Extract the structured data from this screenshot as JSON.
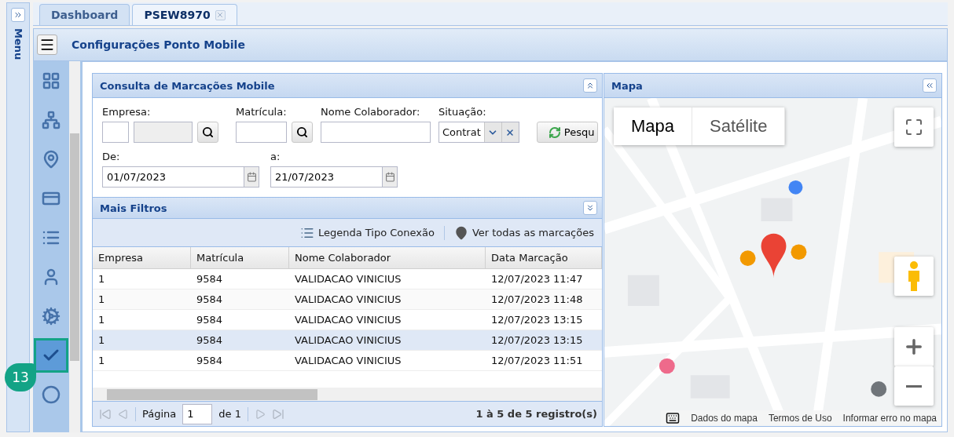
{
  "menu_strip": {
    "label": "Menu"
  },
  "tabs": [
    {
      "label": "Dashboard",
      "selected": false,
      "closable": false
    },
    {
      "label": "PSEW8970",
      "selected": true,
      "closable": true
    }
  ],
  "page_title": "Configurações Ponto Mobile",
  "side_nav": [
    {
      "selected": false
    },
    {
      "selected": false
    },
    {
      "selected": false
    },
    {
      "selected": false
    },
    {
      "selected": false
    },
    {
      "selected": false
    },
    {
      "selected": false
    },
    {
      "selected": true
    },
    {
      "selected": false
    }
  ],
  "callout": {
    "label": "13"
  },
  "search_panel": {
    "title": "Consulta de Marcações Mobile",
    "empresa": {
      "label": "Empresa:"
    },
    "matricula": {
      "label": "Matrícula:"
    },
    "nome": {
      "label": "Nome Colaborador:"
    },
    "situacao": {
      "label": "Situação:",
      "value": "Contrat"
    },
    "search_button": "Pesqu",
    "date_from": {
      "label": "De:",
      "value": "01/07/2023"
    },
    "date_to": {
      "label": "a:",
      "value": "21/07/2023"
    }
  },
  "filters_panel": {
    "title": "Mais Filtros"
  },
  "toolbar": [
    {
      "kind": "legend",
      "label": "Legenda Tipo Conexão"
    },
    {
      "kind": "pin",
      "label": "Ver todas as marcações"
    }
  ],
  "table": {
    "columns": [
      "Empresa",
      "Matrícula",
      "Nome Colaborador",
      "Data Marcação"
    ],
    "rows": [
      {
        "cells": [
          "1",
          "9584",
          "VALIDACAO VINICIUS",
          "12/07/2023 11:47"
        ],
        "selected": false
      },
      {
        "cells": [
          "1",
          "9584",
          "VALIDACAO VINICIUS",
          "12/07/2023 11:48"
        ],
        "selected": false
      },
      {
        "cells": [
          "1",
          "9584",
          "VALIDACAO VINICIUS",
          "12/07/2023 13:15"
        ],
        "selected": false
      },
      {
        "cells": [
          "1",
          "9584",
          "VALIDACAO VINICIUS",
          "12/07/2023 13:15"
        ],
        "selected": true
      },
      {
        "cells": [
          "1",
          "9584",
          "VALIDACAO VINICIUS",
          "12/07/2023 11:51"
        ],
        "selected": false
      }
    ]
  },
  "pager": {
    "page_label": "Página",
    "page": "1",
    "of": "de 1",
    "summary": "1 à 5 de 5 registro(s)"
  },
  "map": {
    "title": "Mapa",
    "map_types": [
      {
        "label": "Mapa",
        "selected": true
      },
      {
        "label": "Satélite",
        "selected": false
      }
    ],
    "footer": [
      "Dados do mapa",
      "Termos de Uso",
      "Informar erro no mapa"
    ]
  }
}
